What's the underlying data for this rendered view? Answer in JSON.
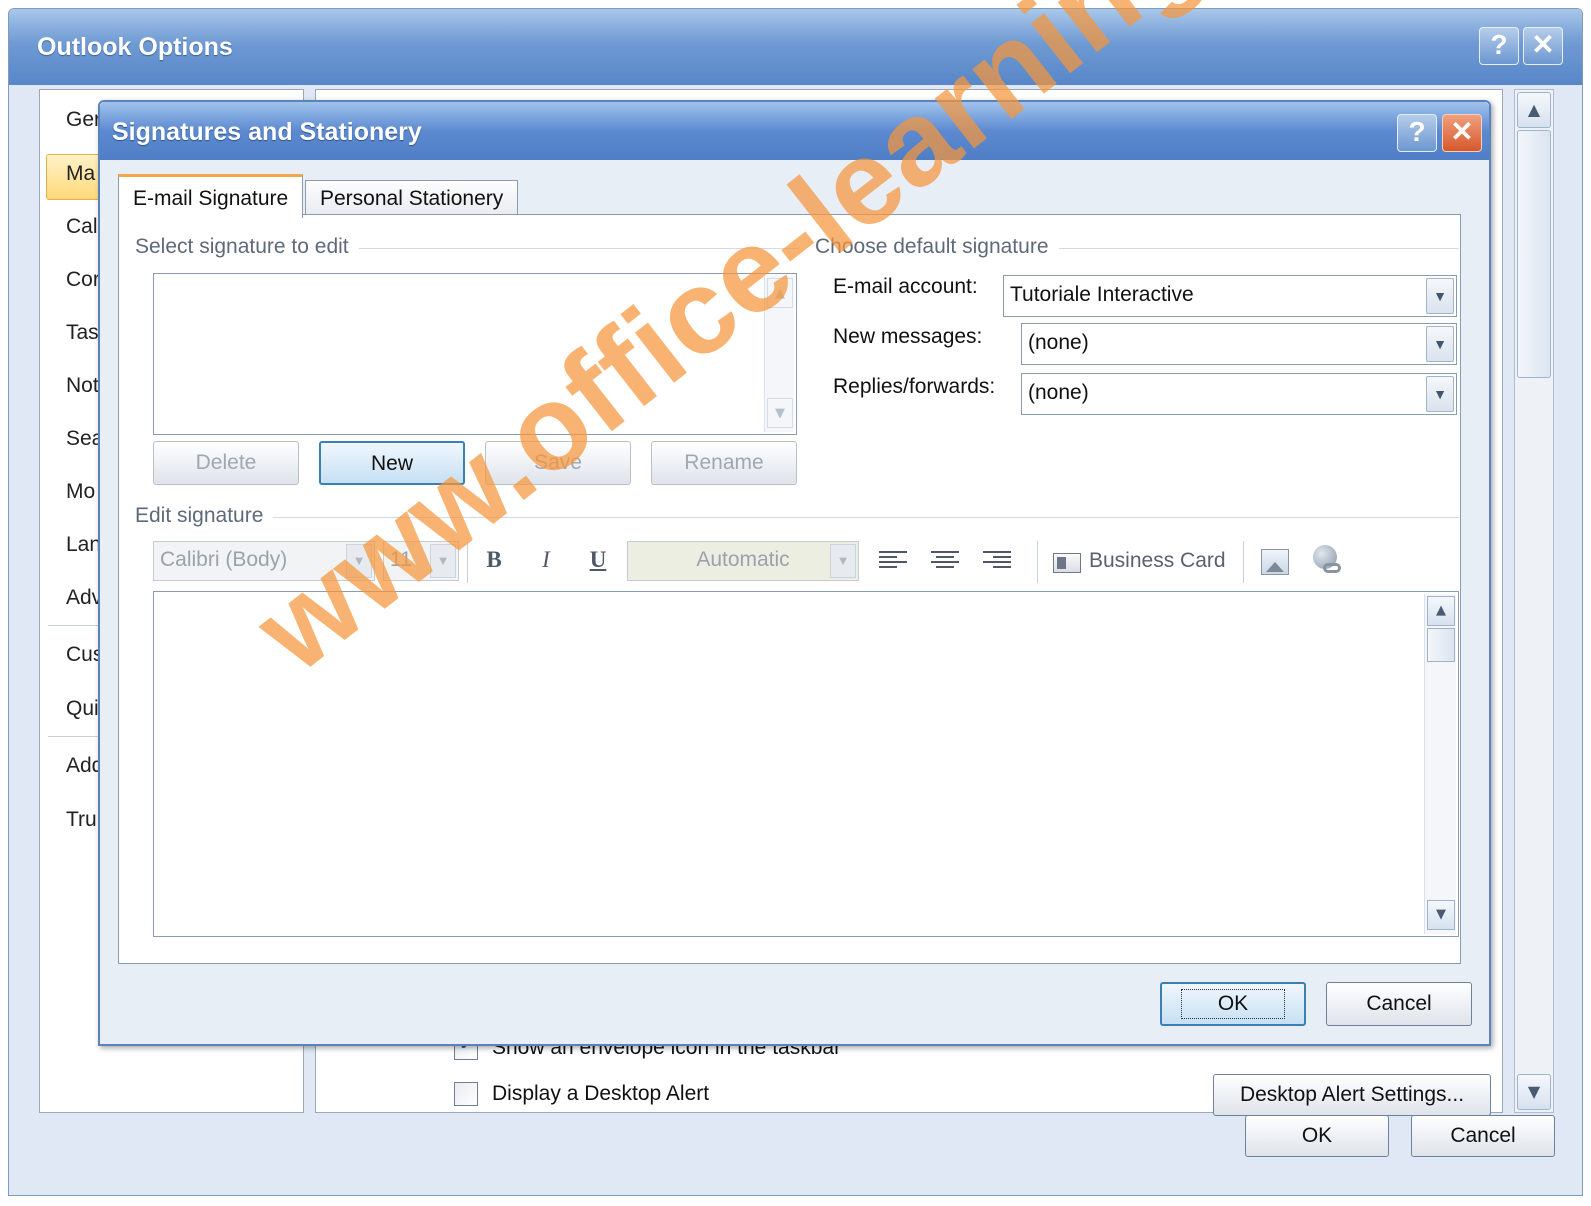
{
  "outer": {
    "title": "Outlook Options",
    "help": "?",
    "close": "✕",
    "nav_items": [
      "Ger",
      "Ma",
      "Cal",
      "Cor",
      "Tas",
      "Not",
      "Sea",
      "Mo",
      "Lan",
      "Adv",
      "Cus",
      "Qui",
      "Add",
      "Tru"
    ],
    "envelope_label": "Show an envelope icon in the taskbar",
    "desktop_alert_label": "Display a Desktop Alert",
    "desktop_alert_settings": "Desktop Alert Settings...",
    "ok": "OK",
    "cancel": "Cancel"
  },
  "dialog": {
    "title": "Signatures and Stationery",
    "help": "?",
    "close": "✕",
    "tabs": [
      "E-mail Signature",
      "Personal Stationery"
    ],
    "select_group": "Select signature to edit",
    "buttons": {
      "delete": "Delete",
      "new": "New",
      "save": "Save",
      "rename": "Rename"
    },
    "default_group": "Choose default signature",
    "email_account_label": "E-mail account:",
    "email_account_value": "Tutoriale Interactive",
    "new_messages_label": "New messages:",
    "new_messages_value": "(none)",
    "replies_label": "Replies/forwards:",
    "replies_value": "(none)",
    "edit_group": "Edit signature",
    "font": "Calibri (Body)",
    "size": "11",
    "bold": "B",
    "italic": "I",
    "underline": "U",
    "color": "Automatic",
    "business_card": "Business Card",
    "ok": "OK",
    "cancel": "Cancel"
  },
  "watermark": "www.office-learning.ro"
}
